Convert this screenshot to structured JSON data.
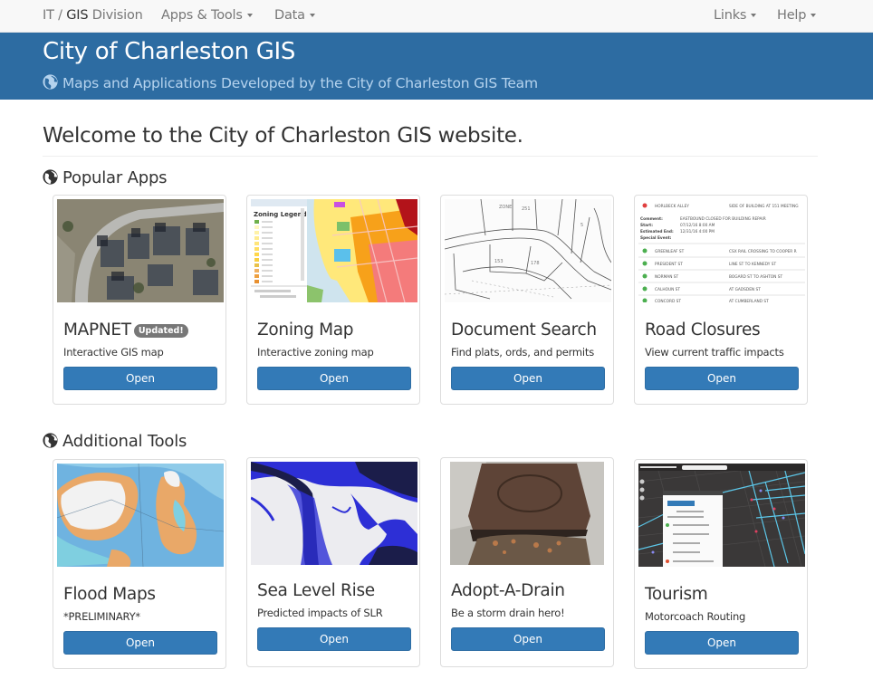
{
  "navbar": {
    "brand_prefix": "IT / ",
    "brand_bold": "GIS",
    "brand_suffix": " Division",
    "left_menus": [
      {
        "label": "Apps & Tools"
      },
      {
        "label": "Data"
      }
    ],
    "right_menus": [
      {
        "label": "Links"
      },
      {
        "label": "Help"
      }
    ]
  },
  "banner": {
    "title": "City of Charleston GIS",
    "subtitle": "Maps and Applications Developed by the City of Charleston GIS Team",
    "icon": "globe-icon"
  },
  "welcome": "Welcome to the City of Charleston GIS website.",
  "sections": [
    {
      "title": "Popular Apps",
      "icon": "globe-icon",
      "cards": [
        {
          "title": "MAPNET",
          "badge": "Updated!",
          "description": "Interactive GIS map",
          "button": "Open",
          "thumbnail": "aerial-photo"
        },
        {
          "title": "Zoning Map",
          "description": "Interactive zoning map",
          "button": "Open",
          "thumbnail": "zoning-map",
          "legend_title": "Zoning Legend"
        },
        {
          "title": "Document Search",
          "description": "Find plats, ords, and permits",
          "button": "Open",
          "thumbnail": "plat-drawing"
        },
        {
          "title": "Road Closures",
          "description": "View current traffic impacts",
          "button": "Open",
          "thumbnail": "closure-list",
          "preview_rows": [
            {
              "street": "HORLBECK ALLEY",
              "detail": "SIDE OF BUILDING AT 151 MEETING",
              "status": "closed"
            },
            {
              "street": "GREENLEAF ST",
              "detail": "CSX RAIL CROSSING TO COOPER R",
              "status": "open"
            },
            {
              "street": "PRESIDENT ST",
              "detail": "LINE ST TO KENNEDY ST",
              "status": "open"
            },
            {
              "street": "NORMAN ST",
              "detail": "BOGARD ST TO ASHTON ST",
              "status": "open"
            },
            {
              "street": "CALHOUN ST",
              "detail": "AT GADSDEN ST",
              "status": "open"
            },
            {
              "street": "CONCORD ST",
              "detail": "AT CUMBERLAND ST",
              "status": "open"
            }
          ],
          "preview_detail": [
            {
              "label": "Comment:",
              "value": "EASTBOUND CLOSED FOR BUILDING REPAIR"
            },
            {
              "label": "Start:",
              "value": "07/12/16 8:00 AM"
            },
            {
              "label": "Estimated End:",
              "value": "12/31/16 4:00 PM"
            },
            {
              "label": "Special Event:",
              "value": ""
            }
          ]
        }
      ]
    },
    {
      "title": "Additional Tools",
      "icon": "globe-icon",
      "cards": [
        {
          "title": "Flood Maps",
          "description": "*PRELIMINARY*",
          "button": "Open",
          "thumbnail": "flood-map"
        },
        {
          "title": "Sea Level Rise",
          "description": "Predicted impacts of SLR",
          "button": "Open",
          "thumbnail": "sea-level-map"
        },
        {
          "title": "Adopt-A-Drain",
          "description": "Be a storm drain hero!",
          "button": "Open",
          "thumbnail": "storm-drain-photo"
        },
        {
          "title": "Tourism",
          "description": "Motorcoach Routing",
          "button": "Open",
          "thumbnail": "motorcoach-map"
        }
      ]
    }
  ],
  "colors": {
    "banner": "#2d6ca2",
    "primary_button": "#337ab7",
    "badge": "#777777",
    "navbar_bg": "#f8f8f8"
  }
}
